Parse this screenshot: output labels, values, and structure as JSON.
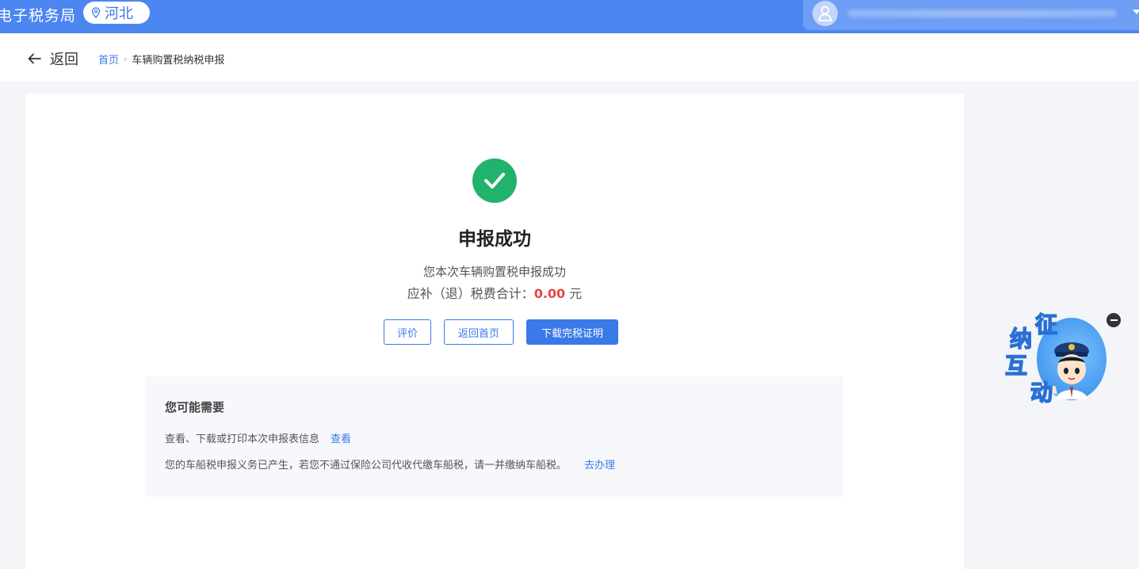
{
  "header": {
    "site_title": "电子税务局",
    "region": "河北",
    "user_name": ""
  },
  "subnav": {
    "back_label": "返回",
    "breadcrumb": {
      "home": "首页",
      "current": "车辆购置税纳税申报"
    }
  },
  "result": {
    "title": "申报成功",
    "description": "您本次车辆购置税申报成功",
    "total_label": "应补（退）税费合计：",
    "total_amount": "0.00",
    "total_unit": "元",
    "buttons": {
      "evaluate": "评价",
      "back_home": "返回首页",
      "download": "下载完税证明"
    }
  },
  "suggestions": {
    "title": "您可能需要",
    "items": [
      {
        "text": "查看、下载或打印本次申报表信息",
        "link": "查看"
      },
      {
        "text": "您的车船税申报义务已产生，若您不通过保险公司代收代缴车船税，请一并缴纳车船税。",
        "link": "去办理"
      }
    ]
  },
  "mascot": {
    "label_chars": [
      "征",
      "纳",
      "互",
      "动"
    ]
  },
  "colors": {
    "header_bg": "#4b86f1",
    "primary": "#3a79e8",
    "success": "#21b26b",
    "amount": "#e64545"
  }
}
